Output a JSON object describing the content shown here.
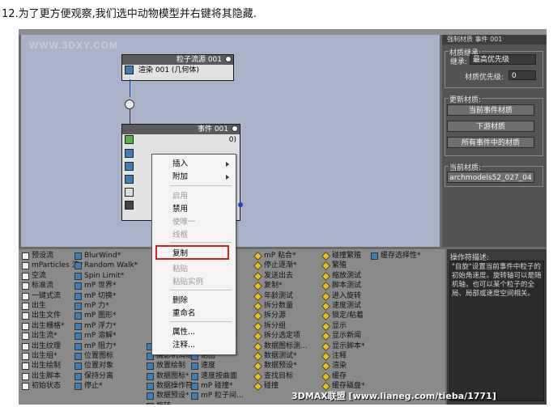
{
  "caption": "12.为了更方便观察,我们选中动物模型并右键将其隐藏.",
  "viewport": {
    "watermark": "WWW.3DXY.COM",
    "node_source": {
      "title": "粒子流源 001",
      "row": "渲染 001 (几何体)"
    },
    "node_event": {
      "title": "事件 001",
      "row_suffix": "0)"
    }
  },
  "context_menu": {
    "items": [
      {
        "label": "插入",
        "enabled": true,
        "submenu": true
      },
      {
        "label": "附加",
        "enabled": true,
        "submenu": true
      },
      {
        "label": "启用",
        "enabled": false
      },
      {
        "label": "禁用",
        "enabled": true
      },
      {
        "label": "使唯一",
        "enabled": false
      },
      {
        "label": "线框",
        "enabled": false
      },
      {
        "label": "复制",
        "enabled": true,
        "highlighted": true
      },
      {
        "label": "粘贴",
        "enabled": false
      },
      {
        "label": "粘贴实例",
        "enabled": false
      },
      {
        "label": "删除",
        "enabled": true
      },
      {
        "label": "重命名",
        "enabled": true
      },
      {
        "label": "属性...",
        "enabled": true
      },
      {
        "label": "注释...",
        "enabled": true
      }
    ]
  },
  "right_panel": {
    "title": "强制材质 事件 001",
    "inherit_group": "材质继承:",
    "inherit_label": "继承:",
    "inherit_value": "最高优先级",
    "priority_label": "材质优先级:",
    "priority_value": "0",
    "update_group": "更新材质:",
    "btn_current": "当前事件材质",
    "btn_downstream": "下游材质",
    "btn_all": "所有事件中的材质",
    "current_group": "当前材质:",
    "current_value": "archmodels52_027_04"
  },
  "depot": {
    "columns": [
      [
        "预设流",
        "mParticles 流*",
        "空流",
        "标准流",
        "一键式流",
        "出生",
        "出生文件",
        "出生栅格*",
        "出生流*",
        "出生纹理",
        "出生组*",
        "出生绘制",
        "出生脚本",
        "初始状态"
      ],
      [
        "BlurWind*",
        "Random Walk*",
        "Spin Limit*",
        "mP 世界*",
        "mP 切换*",
        "mP 力*",
        "mP 图形*",
        "mP 浮力*",
        "mP 溶解*",
        "mP 阻力*",
        "位置图标",
        "位置对象",
        "保持分离",
        "停止*"
      ],
      [
        "",
        "",
        "",
        "",
        "",
        "",
        "",
        "",
        "",
        "摄影机 IMBlur*",
        "摄影机消隐*",
        "放置绘制",
        "数据图标*",
        "数据操作符*",
        "数据预设*",
        "旋转"
      ],
      [
        "对象",
        "动态",
        "静态",
        "频率",
        "作符",
        "缩放",
        "",
        "",
        "脚本操作符",
        "自旋",
        "贴图",
        "速度",
        "速度按曲面",
        "mP 碰撞*",
        "mP 粒子间..."
      ],
      [
        "mP 粘合*",
        "停止逐渐*",
        "发送出去",
        "复制*",
        "年龄测试",
        "拆分数量",
        "拆分源",
        "拆分组",
        "拆分选定项",
        "数据图标测...",
        "数据测试*",
        "数据预设*",
        "查找目标",
        "碰撞"
      ],
      [
        "碰撞繁殖",
        "繁殖",
        "缩放测试",
        "脚本测试",
        "进入旋转",
        "速度测试",
        "锁定/粘着",
        "显示",
        "显示新闻",
        "显示脚本*",
        "注释",
        "渲染",
        "缓存",
        "缓存磁盘*"
      ],
      [
        "缓存选择性*"
      ]
    ]
  },
  "description": {
    "label": "操作符描述:",
    "text": "\"自旋\"设置当前事件中粒子的初始角速度。旋转轴可以是随机轴，也可以某个粒子的全局、局部或速度空间相关。"
  },
  "footer_watermark": "3DMAX联盟 [www.lianeg.com/tieba/1771]"
}
